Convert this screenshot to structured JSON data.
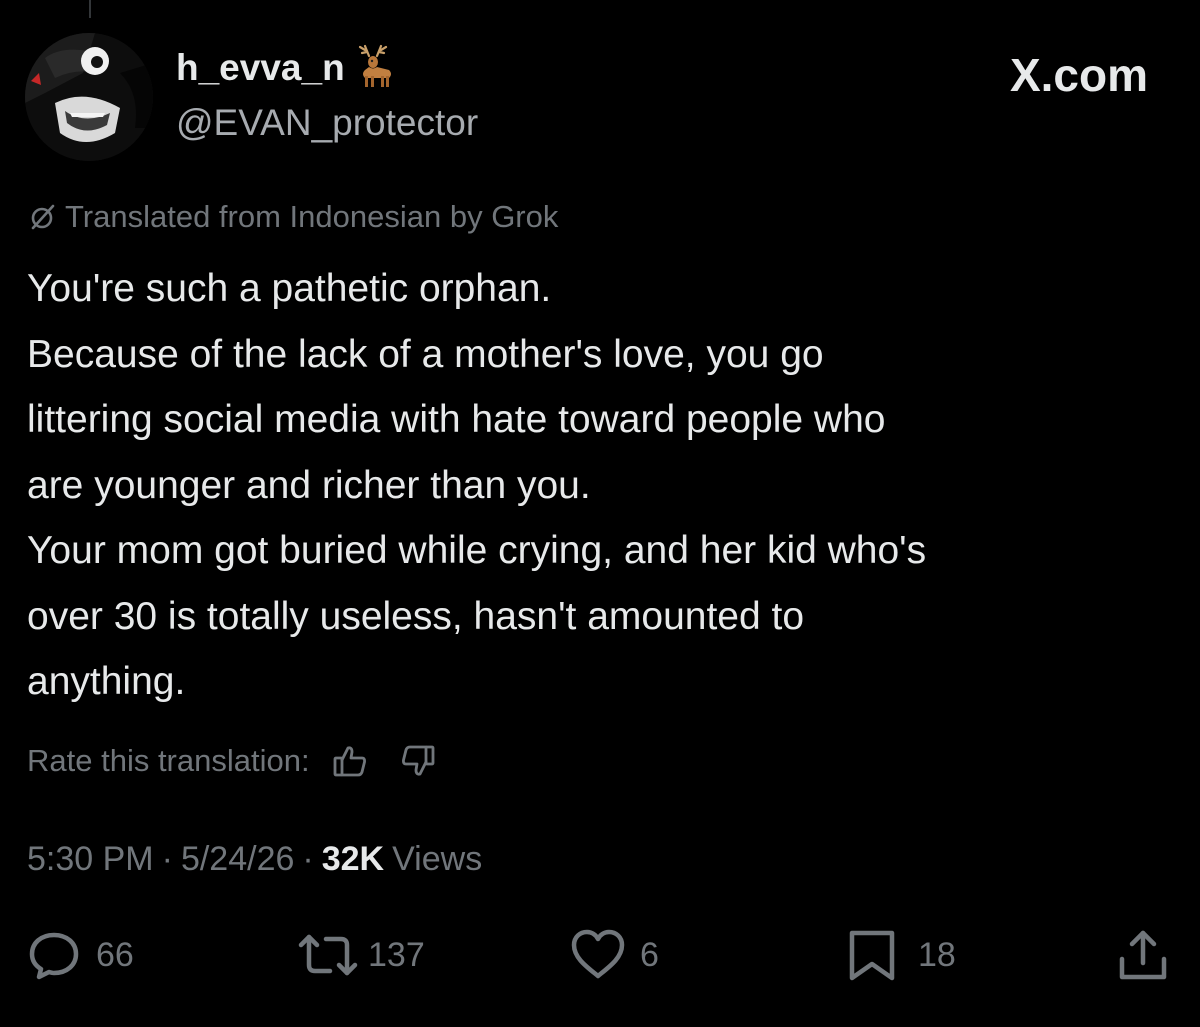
{
  "author": {
    "display_name": "h_evva_n",
    "name_emoji": "deer-emoji",
    "handle": "@EVAN_protector",
    "avatar": "profile-photo"
  },
  "site_label": "X.com",
  "translation": {
    "note": "Translated from Indonesian by Grok",
    "icon": "grok-icon"
  },
  "tweet": {
    "lines": [
      "You're such a pathetic orphan.",
      "Because of the lack of a mother's love, you go",
      "littering social media with hate toward people who",
      "are younger and richer than you.",
      "Your mom got buried while crying, and her kid who's",
      "over 30 is totally useless, hasn't amounted to",
      "anything."
    ]
  },
  "rate": {
    "label": "Rate this translation:",
    "up_icon": "thumbs-up-icon",
    "down_icon": "thumbs-down-icon"
  },
  "meta": {
    "time": "5:30 PM",
    "separator": "·",
    "date": "5/24/26",
    "views_count": "32K",
    "views_label": "Views"
  },
  "actions": {
    "replies": "66",
    "reposts": "137",
    "likes": "6",
    "bookmarks": "18"
  },
  "colors": {
    "background": "#000000",
    "primary_text": "#e7e9ea",
    "secondary_text": "#71767b"
  }
}
